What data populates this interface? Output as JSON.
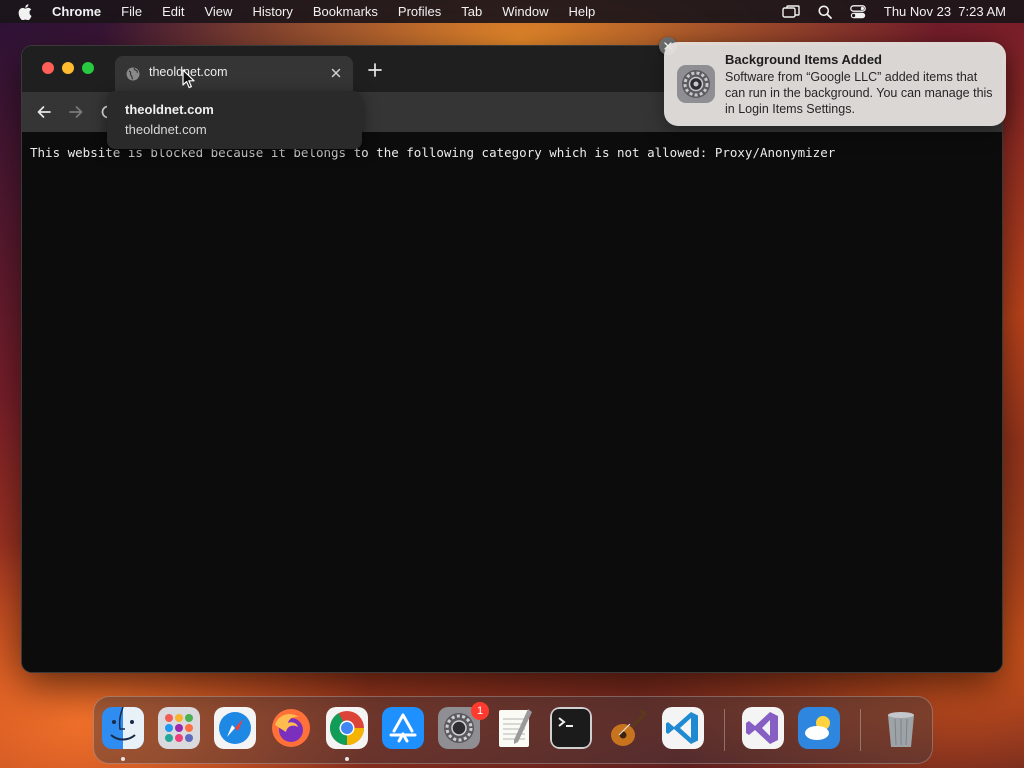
{
  "menubar": {
    "app_name": "Chrome",
    "items": [
      "File",
      "Edit",
      "View",
      "History",
      "Bookmarks",
      "Profiles",
      "Tab",
      "Window",
      "Help"
    ],
    "datetime": "Thu Nov 23  7:23 AM"
  },
  "browser": {
    "tab": {
      "title": "theoldnet.com",
      "icon": "globe-icon"
    },
    "hover_card": {
      "title": "theoldnet.com",
      "domain": "theoldnet.com"
    },
    "page_message": "This website is blocked because it belongs to the following category which is not allowed: Proxy/Anonymizer"
  },
  "notification": {
    "title": "Background Items Added",
    "body": "Software from “Google LLC” added items that can run in the background. You can manage this in Login Items Settings.",
    "icon": "system-settings-icon"
  },
  "dock": {
    "apps": [
      "Finder",
      "Launchpad",
      "Safari",
      "Firefox",
      "Google Chrome",
      "App Store",
      "System Settings",
      "TextEdit",
      "Terminal",
      "GarageBand",
      "Visual Studio Code",
      "Visual Studio",
      "Weather",
      "Trash"
    ],
    "settings_badge": "1"
  },
  "colors": {
    "notification_badge": "#ff3b30",
    "traffic_close": "#ff5f57",
    "traffic_min": "#febc2e",
    "traffic_max": "#28c840"
  }
}
